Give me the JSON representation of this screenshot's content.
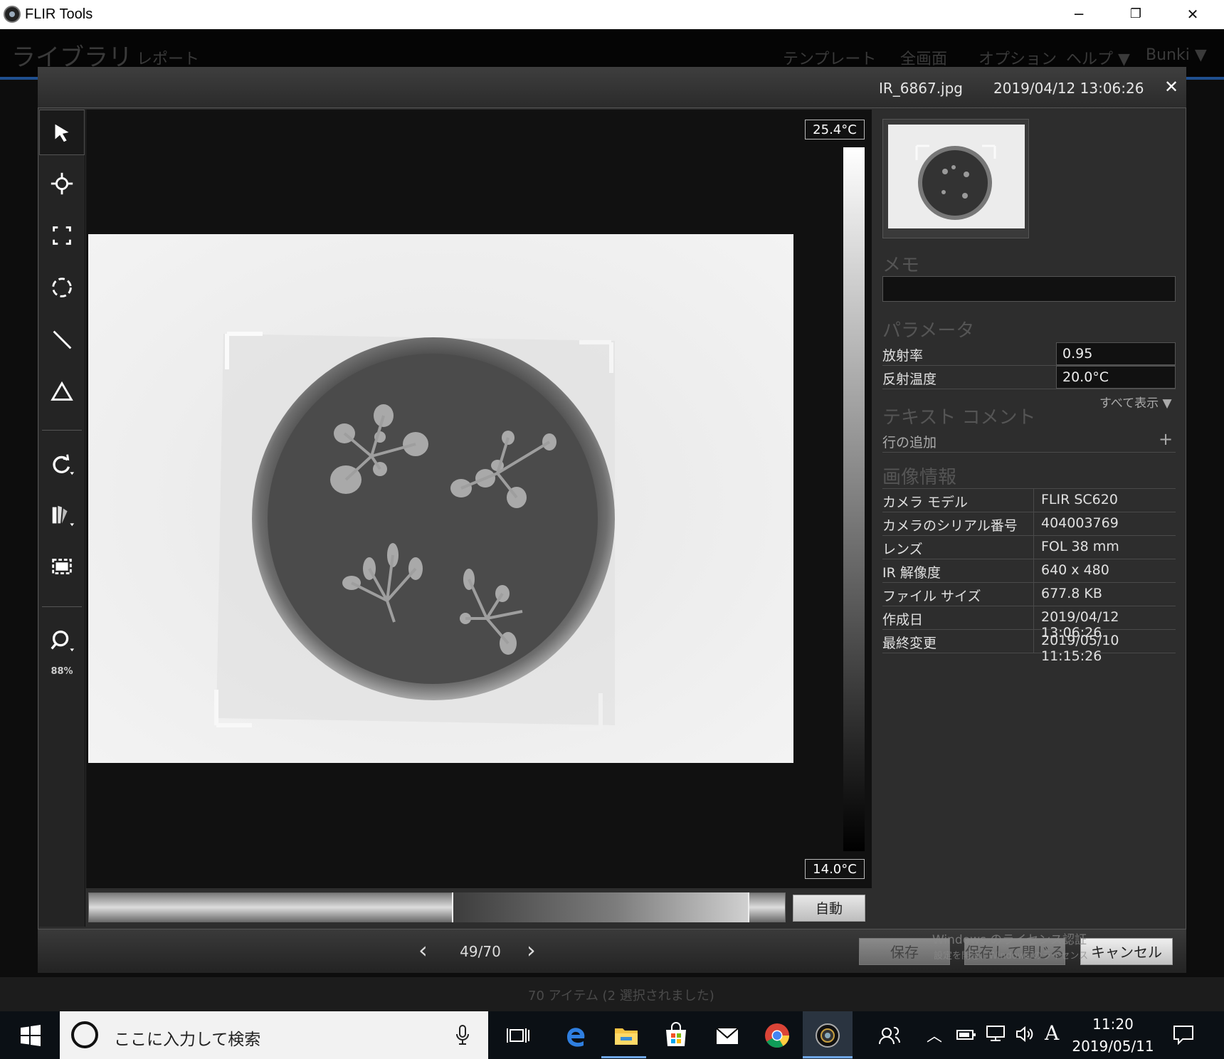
{
  "window": {
    "title": "FLIR Tools",
    "minimize": "─",
    "maximize": "❐",
    "close": "✕"
  },
  "background_app": {
    "menu": [
      "ライブラリ",
      "レポート",
      "テンプレート",
      "全画面",
      "オプション",
      "ヘルプ ▼",
      "Bunki ▼"
    ],
    "status": "70 アイテム (2 選択されました)"
  },
  "dialog": {
    "filename": "IR_6867.jpg",
    "datetime": "2019/04/12 13:06:26",
    "close": "✕"
  },
  "toolbar": {
    "tools": [
      "select-tool",
      "spot-tool",
      "box-tool",
      "ellipse-tool",
      "line-tool",
      "delta-tool",
      "rotate-tool",
      "palette-tool",
      "fit-tool",
      "zoom-tool"
    ],
    "zoom_percent": "88%"
  },
  "viewer": {
    "temp_max": "25.4°C",
    "temp_min": "14.0°C",
    "auto_button": "自動"
  },
  "panel": {
    "memo_heading": "メモ",
    "params_heading": "パラメータ",
    "params": [
      {
        "label": "放射率",
        "value": "0.95"
      },
      {
        "label": "反射温度",
        "value": "20.0°C"
      }
    ],
    "show_all": "すべて表示 ▼",
    "text_comment_heading": "テキスト コメント",
    "add_row": "行の追加",
    "add_row_icon": "+",
    "image_info_heading": "画像情報",
    "image_info": [
      {
        "label": "カメラ モデル",
        "value": "FLIR SC620"
      },
      {
        "label": "カメラのシリアル番号",
        "value": "404003769"
      },
      {
        "label": "レンズ",
        "value": "FOL 38 mm"
      },
      {
        "label": "IR 解像度",
        "value": "640 x 480"
      },
      {
        "label": "ファイル サイズ",
        "value": "677.8 KB"
      },
      {
        "label": "作成日",
        "value": "2019/04/12 13:06:26"
      },
      {
        "label": "最終変更",
        "value": "2019/05/10 11:15:26"
      }
    ]
  },
  "footer": {
    "prev": "‹",
    "counter": "49/70",
    "next": "›",
    "save": "保存",
    "save_close": "保存して閉じる",
    "cancel": "キャンセル",
    "watermark_line1": "Windows のライセンス認証",
    "watermark_line2": "設定を開き、Windows のライセンス"
  },
  "taskbar": {
    "search_placeholder": "ここに入力して検索",
    "ime": "A",
    "time": "11:20",
    "date": "2019/05/11"
  }
}
